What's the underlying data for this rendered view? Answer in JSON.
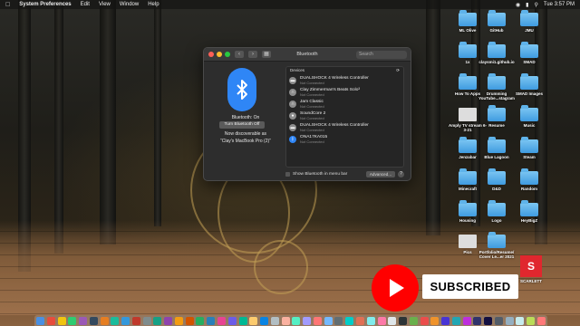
{
  "menubar": {
    "apple_icon": "apple-icon",
    "app_name": "System Preferences",
    "items": [
      "Edit",
      "View",
      "Window",
      "Help"
    ],
    "clock": "Tue 3:57 PM"
  },
  "window": {
    "title": "Bluetooth",
    "search_placeholder": "Search",
    "left": {
      "status": "Bluetooth: On",
      "toggle_label": "Turn Bluetooth Off",
      "discoverable": "Now discoverable as",
      "device_name": "“Clay's MacBook Pro (2)”"
    },
    "devices_header": "Devices",
    "devices": [
      {
        "name": "DUALSHOCK 4 Wireless Controller",
        "status": "Not Connected",
        "icon": "gamepad-icon",
        "color": "#8d8d8d"
      },
      {
        "name": "Clay Zimmerman's Beats Solo³",
        "status": "Not Connected",
        "icon": "headphones-icon",
        "color": "#8d8d8d"
      },
      {
        "name": "Jam Classic",
        "status": "Not Connected",
        "icon": "headphones-icon",
        "color": "#8d8d8d"
      },
      {
        "name": "SoundCore 2",
        "status": "Not Connected",
        "icon": "speaker-icon",
        "color": "#8d8d8d"
      },
      {
        "name": "DUALSHOCK 4 Wireless Controller",
        "status": "Not Connected",
        "icon": "gamepad-icon",
        "color": "#8d8d8d"
      },
      {
        "name": "ONA17KA015",
        "status": "Not Connected",
        "icon": "bluetooth-icon",
        "color": "#2f86f6"
      }
    ],
    "show_in_menubar_label": "Show Bluetooth in menu bar",
    "advanced_label": "Advanced...",
    "help_label": "?"
  },
  "desktop_icons": [
    {
      "label": "ML Olive"
    },
    {
      "label": "GitHub"
    },
    {
      "label": "JMU"
    },
    {
      "label": "1x"
    },
    {
      "label": "claysmi1.github.io"
    },
    {
      "label": "SMAD"
    },
    {
      "label": "How To Apps"
    },
    {
      "label": "Drumming YouTube...stagram"
    },
    {
      "label": "SMAD Images"
    },
    {
      "label": "Amply TV stream 6-3-21"
    },
    {
      "label": "Resume"
    },
    {
      "label": "Music"
    },
    {
      "label": "Jenzabar"
    },
    {
      "label": "Blue Lagoon"
    },
    {
      "label": "Steam"
    },
    {
      "label": "Minecraft"
    },
    {
      "label": "D&D"
    },
    {
      "label": "Random"
    },
    {
      "label": "Housing"
    },
    {
      "label": "Logo"
    },
    {
      "label": "HeyBigZ"
    },
    {
      "label": "Pics"
    },
    {
      "label": "Portfolio/Resume/ Cover Le...er 2021"
    }
  ],
  "overlay": {
    "subscribe_label": "SUBSCRIBED",
    "scarlett_letter": "S",
    "scarlett_label": "SCARLETT"
  },
  "dock": {
    "apps": [
      "#4a90e2",
      "#e74c3c",
      "#f1c40f",
      "#2ecc71",
      "#9b59b6",
      "#34495e",
      "#e67e22",
      "#1abc9c",
      "#3498db",
      "#c0392b",
      "#7f8c8d",
      "#16a085",
      "#8e44ad",
      "#f39c12",
      "#d35400",
      "#27ae60",
      "#2980b9",
      "#e84393",
      "#6c5ce7",
      "#00b894",
      "#fdcb6e",
      "#0984e3",
      "#b2bec3",
      "#fab1a0",
      "#55efc4",
      "#a29bfe",
      "#ff7675",
      "#74b9ff",
      "#636e72",
      "#00cec9",
      "#e17055",
      "#81ecec",
      "#fd79a8",
      "#dfe6e9",
      "#2d3436",
      "#6ab04c",
      "#eb4d4b",
      "#f0932b",
      "#4834d4",
      "#22a6b3",
      "#be2edd",
      "#30336b",
      "#130f40",
      "#535c68",
      "#95afc0",
      "#c7ecee",
      "#badc58",
      "#ff7979"
    ]
  }
}
